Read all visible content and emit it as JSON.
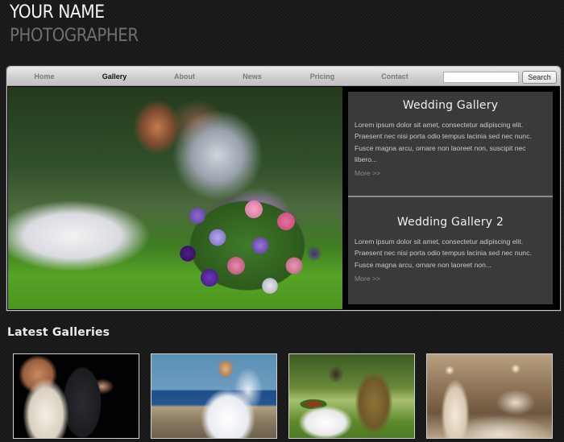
{
  "brand": {
    "name": "YOUR NAME",
    "title": "PHOTOGRAPHER"
  },
  "nav": {
    "items": [
      {
        "label": "Home",
        "active": false
      },
      {
        "label": "Gallery",
        "active": true
      },
      {
        "label": "About",
        "active": false
      },
      {
        "label": "News",
        "active": false
      },
      {
        "label": "Pricing",
        "active": false
      },
      {
        "label": "Contact",
        "active": false
      }
    ],
    "search": {
      "value": "",
      "placeholder": "",
      "button_label": "Search"
    }
  },
  "hero": {
    "image_alt": "Blurred wedding couple kissing on grass with a colorful bouquet of roses in the foreground"
  },
  "sidebar": {
    "panels": [
      {
        "title": "Wedding Gallery",
        "text": "Lorem ipsum dolor sit amet, consectetur adipiscing elit. Praesent nec nisi porta odio tempus lacinia sed nec nunc. Fusce magna arcu, ornare non laoreet non, suscipit nec libero...",
        "more": "More >>"
      },
      {
        "title": "Wedding Gallery 2",
        "text": "Lorem ipsum dolor sit amet, consectetur adipiscing elit. Praesent nec nisi porta odio tempus lacinia sed nec nunc. Fusce magna arcu, ornare non laoreet non...",
        "more": "More >>"
      }
    ]
  },
  "latest": {
    "heading": "Latest Galleries",
    "thumbnails": [
      {
        "alt": "Bride and groom dancing against black background"
      },
      {
        "alt": "Bride with flowing veil by the sea"
      },
      {
        "alt": "Couple in the park with red roses"
      },
      {
        "alt": "Sepia photo of first dance with confetti"
      }
    ]
  }
}
